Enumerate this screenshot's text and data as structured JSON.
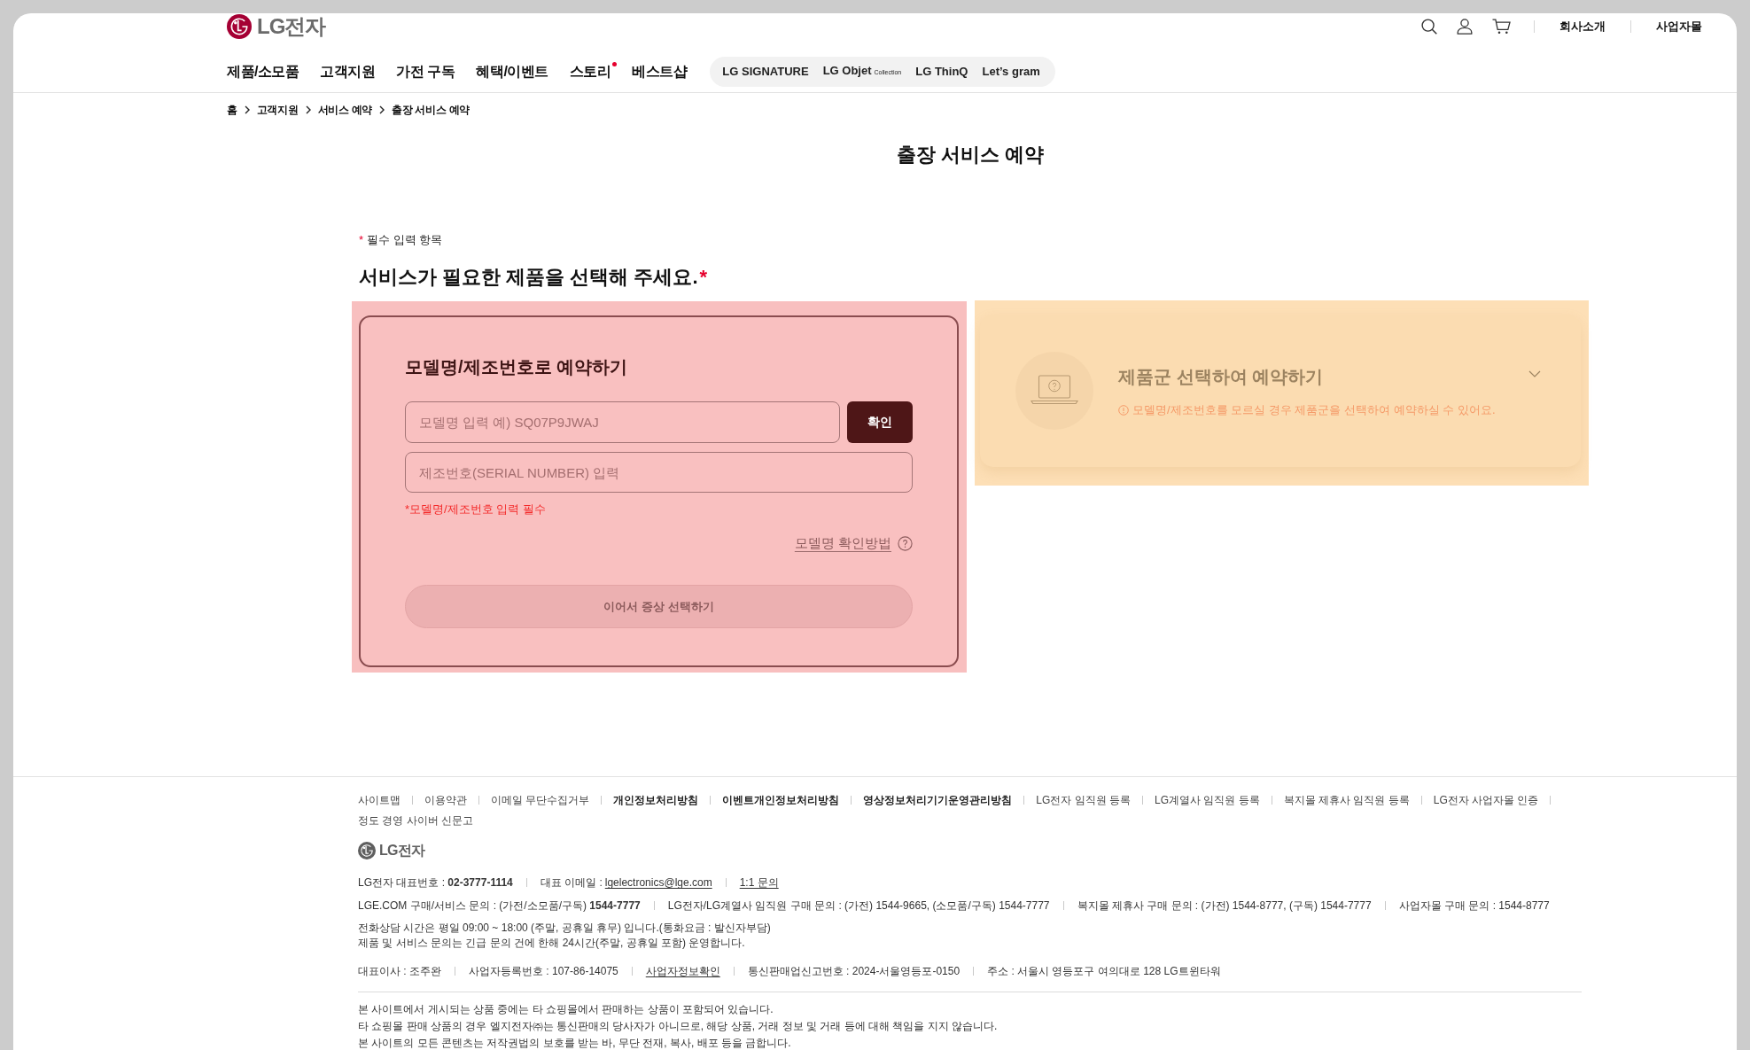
{
  "header": {
    "logo": "LG전자",
    "utility_links": [
      "회사소개",
      "사업자몰"
    ],
    "nav": [
      {
        "label": "제품/소모품",
        "new": false
      },
      {
        "label": "고객지원",
        "new": false
      },
      {
        "label": "가전 구독",
        "new": false
      },
      {
        "label": "혜택/이벤트",
        "new": false
      },
      {
        "label": "스토리",
        "new": true
      },
      {
        "label": "베스트샵",
        "new": false
      }
    ],
    "brands": [
      {
        "label": "LG SIGNATURE"
      },
      {
        "label": "LG Objet",
        "sub": "Collection"
      },
      {
        "label": "LG ThinQ"
      },
      {
        "label": "Let’s gram"
      }
    ]
  },
  "breadcrumb": [
    "홈",
    "고객지원",
    "서비스 예약",
    "출장 서비스 예약"
  ],
  "page_title": "출장 서비스 예약",
  "required_note": {
    "marker": "*",
    "text": "필수 입력 항목"
  },
  "question": {
    "text": "서비스가 필요한 제품을 선택해 주세요.",
    "marker": "*"
  },
  "model_card": {
    "title": "모델명/제조번호로 예약하기",
    "model_field": {
      "placeholder": "모델명 입력 예) SQ07P9JWAJ"
    },
    "confirm_button": "확인",
    "serial_field": {
      "placeholder": "제조번호(SERIAL NUMBER) 입력"
    },
    "error": "*모델명/제조번호 입력 필수",
    "help_link": "모델명 확인방법",
    "next_button": {
      "label": "이어서 증상 선택하기",
      "disabled": true
    }
  },
  "product_group_card": {
    "title": "제품군 선택하여 예약하기",
    "note": "모델명/제조번호를 모르실 경우 제품군을 선택하여 예약하실 수 있어요.",
    "expanded": false
  },
  "footer": {
    "links": [
      {
        "label": "사이트맵",
        "bold": false
      },
      {
        "label": "이용약관",
        "bold": false
      },
      {
        "label": "이메일 무단수집거부",
        "bold": false
      },
      {
        "label": "개인정보처리방침",
        "bold": true
      },
      {
        "label": "이벤트개인정보처리방침",
        "bold": true
      },
      {
        "label": "영상정보처리기기운영관리방침",
        "bold": true
      },
      {
        "label": "LG전자 임직원 등록",
        "bold": false
      },
      {
        "label": "LG계열사 임직원 등록",
        "bold": false
      },
      {
        "label": "복지몰 제휴사 임직원 등록",
        "bold": false
      },
      {
        "label": "LG전자 사업자몰 인증",
        "bold": false
      },
      {
        "label": "정도 경영 사이버 신문고",
        "bold": false
      }
    ],
    "logo": "LG전자",
    "info": [
      {
        "kind": "row",
        "groups": [
          [
            {
              "kind": "text",
              "text": "LG전자 대표번호 : **02-3777-1114**"
            }
          ],
          [
            {
              "kind": "text",
              "text": "대표 이메일 :"
            },
            {
              "kind": "link",
              "text": "lgelectronics@lge.com"
            }
          ],
          [
            {
              "kind": "link",
              "text": "1:1 문의"
            }
          ]
        ]
      },
      {
        "kind": "row",
        "groups": [
          [
            {
              "kind": "text",
              "text": "LGE.COM 구매/서비스 문의 : (가전/소모품/구독) **1544-7777**"
            }
          ],
          [
            {
              "kind": "text",
              "text": "LG전자/LG계열사 임직원 구매 문의 : (가전) 1544-9665, (소모품/구독) 1544-7777"
            }
          ],
          [
            {
              "kind": "text",
              "text": "복지몰 제휴사 구매 문의 : (가전) 1544-8777, (구독) 1544-7777"
            }
          ],
          [
            {
              "kind": "text",
              "text": "사업자몰 구매 문의 : 1544-8777"
            }
          ]
        ]
      },
      {
        "kind": "paragraph",
        "lines": [
          "전화상담 시간은 평일 09:00 ~ 18:00 (주말, 공휴일 휴무) 입니다.(통화요금 : 발신자부담)",
          "제품 및 서비스 문의는 긴급 문의 건에 한해 24시간(주말, 공휴일 포함) 운영합니다."
        ]
      },
      {
        "kind": "row",
        "groups": [
          [
            {
              "kind": "text",
              "text": "대표이사 : 조주완"
            }
          ],
          [
            {
              "kind": "text",
              "text": "사업자등록번호 : 107-86-14075"
            }
          ],
          [
            {
              "kind": "link",
              "text": "사업자정보확인"
            }
          ],
          [
            {
              "kind": "text",
              "text": "통신판매업신고번호 : 2024-서울영등포-0150"
            }
          ],
          [
            {
              "kind": "text",
              "text": "주소 : 서울시 영등포구 여의대로 128 LG트윈타워"
            }
          ]
        ]
      }
    ],
    "notices": [
      "본 사이트에서 게시되는 상품 중에는 타 쇼핑몰에서 판매하는 상품이 포함되어 있습니다.",
      "타 쇼핑몰 판매 상품의 경우 엘지전자㈜는 통신판매의 당사자가 아니므로, 해당 상품, 거래 정보 및 거래 등에 대해 책임을 지지 않습니다.",
      "본 사이트의 모든 콘텐츠는 저작권법의 보호를 받는 바, 무단 전재, 복사, 배포 등을 금합니다."
    ]
  }
}
